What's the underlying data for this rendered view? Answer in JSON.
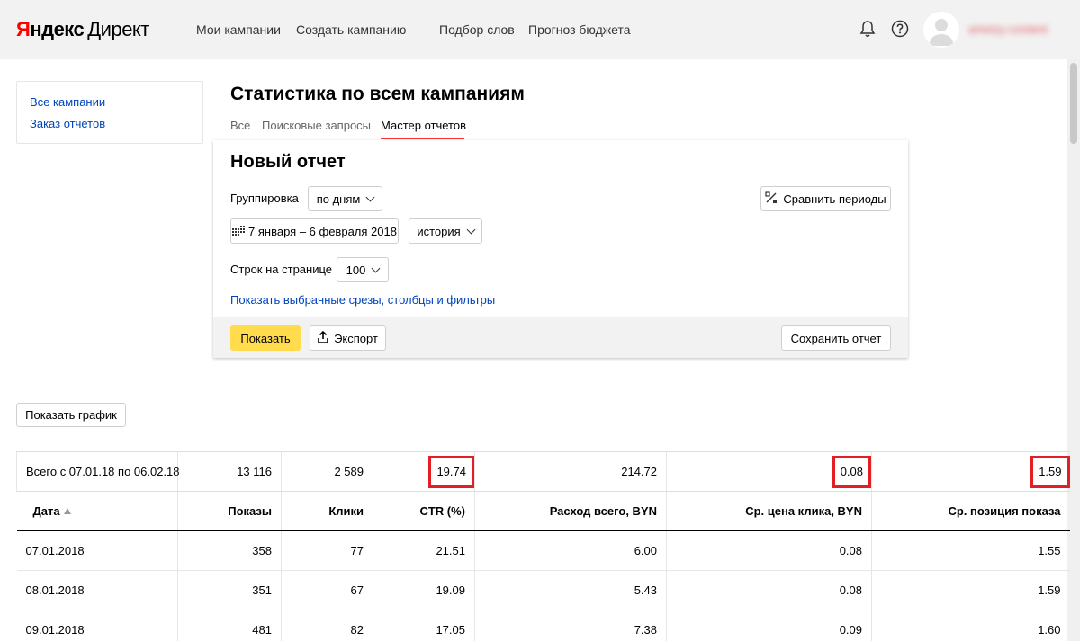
{
  "header": {
    "logo_brand": "Яндекс",
    "logo_product": "Директ",
    "nav": [
      "Мои кампании",
      "Создать кампанию",
      "Подбор слов",
      "Прогноз бюджета"
    ],
    "username": "ameizy-content"
  },
  "sidebar": {
    "items": [
      "Все кампании",
      "Заказ отчетов"
    ]
  },
  "page": {
    "title": "Статистика по всем кампаниям",
    "tabs": [
      {
        "label": "Все",
        "active": false
      },
      {
        "label": "Поисковые запросы",
        "active": false
      },
      {
        "label": "Мастер отчетов",
        "active": true
      }
    ]
  },
  "report": {
    "title": "Новый отчет",
    "grouping_label": "Группировка",
    "grouping_value": "по дням",
    "compare_label": "Сравнить периоды",
    "date_range": "7 января – 6 февраля 2018",
    "history_value": "история",
    "rows_label": "Строк на странице",
    "rows_value": "100",
    "show_filters_link": "Показать выбранные срезы, столбцы и фильтры",
    "show_button": "Показать",
    "export_button": "Экспорт",
    "save_button": "Сохранить отчет"
  },
  "show_chart_button": "Показать график",
  "table": {
    "total": [
      "Всего с 07.01.18 по 06.02.18",
      "13 116",
      "2 589",
      "19.74",
      "214.72",
      "0.08",
      "1.59"
    ],
    "columns": [
      "Дата",
      "Показы",
      "Клики",
      "CTR (%)",
      "Расход всего, BYN",
      "Ср. цена клика, BYN",
      "Ср. позиция показа"
    ],
    "rows": [
      [
        "07.01.2018",
        "358",
        "77",
        "21.51",
        "6.00",
        "0.08",
        "1.55"
      ],
      [
        "08.01.2018",
        "351",
        "67",
        "19.09",
        "5.43",
        "0.08",
        "1.59"
      ],
      [
        "09.01.2018",
        "481",
        "82",
        "17.05",
        "7.38",
        "0.09",
        "1.60"
      ]
    ]
  },
  "colors": {
    "header_bg": "#f2f2f2",
    "accent_red": "#ff3333",
    "highlight_red": "#e31e24",
    "link_blue": "#0044bb",
    "button_yellow": "#ffdb4d"
  }
}
